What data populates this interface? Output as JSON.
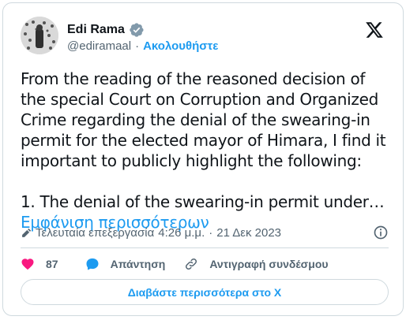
{
  "author": {
    "name": "Edi Rama",
    "handle": "@ediramaal",
    "follow_label": "Ακολουθήστε"
  },
  "tweet": {
    "paragraph1": "From the reading of the reasoned decision of the special Court on Corruption and Organized Crime regarding the denial of the swearing-in permit for the elected mayor of Himara, I find it important to publicly highlight the following:",
    "paragraph2": "1. The denial of the swearing-in permit under…",
    "show_more": "Εμφάνιση περισσότερων"
  },
  "meta": {
    "edited_label": "Τελευταία επεξεργασία",
    "time": "4:26 μ.μ.",
    "separator": "·",
    "date": "21 Δεκ 2023"
  },
  "actions": {
    "like_count": "87",
    "reply_label": "Απάντηση",
    "copy_link_label": "Αντιγραφή συνδέσμου"
  },
  "read_more_label": "Διαβάστε περισσότερα στο X",
  "colors": {
    "accent": "#1d9bf0",
    "heart": "#f91880",
    "text": "#0f1419",
    "muted": "#536471",
    "border": "#cfd9de"
  },
  "icons": [
    "verified-badge-icon",
    "x-logo-icon",
    "pencil-icon",
    "info-icon",
    "heart-icon",
    "reply-bubble-icon",
    "link-icon"
  ]
}
